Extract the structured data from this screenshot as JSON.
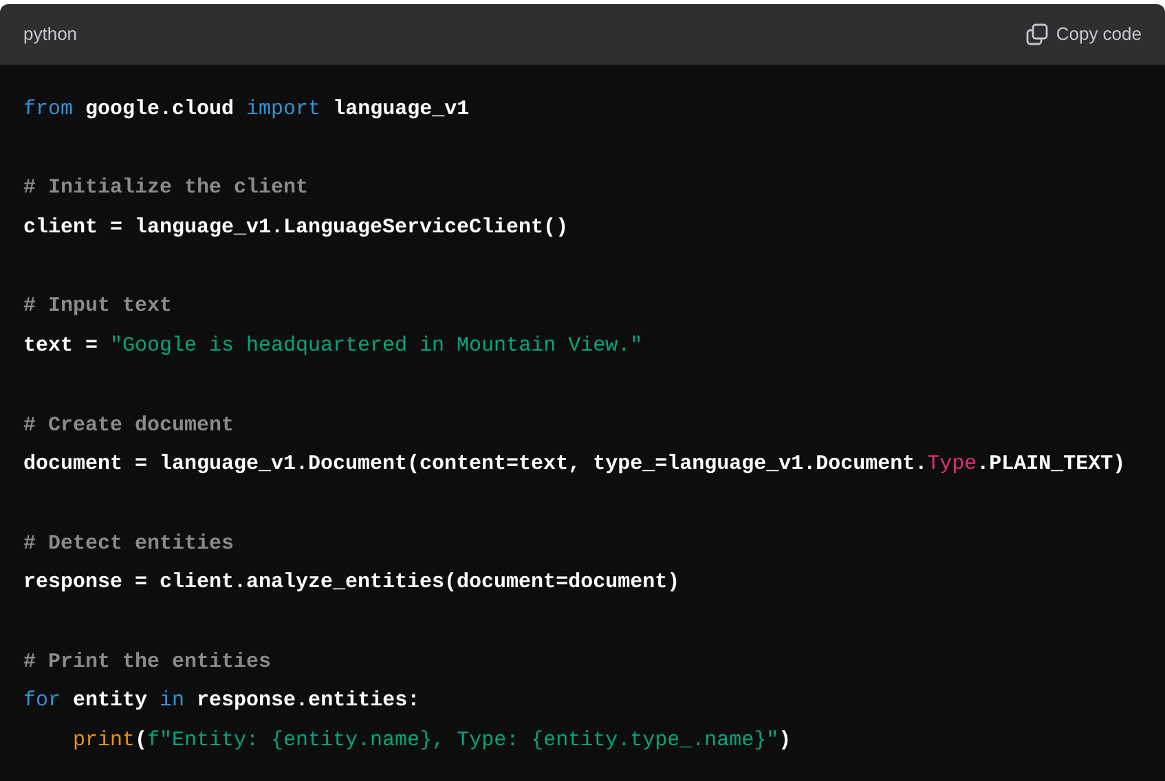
{
  "header": {
    "language": "python",
    "copy_label": "Copy code"
  },
  "lines": [
    {
      "kind": "code",
      "tokens": [
        {
          "kind": "keyword",
          "text": "from"
        },
        {
          "kind": "plain",
          "text": " google.cloud "
        },
        {
          "kind": "keyword",
          "text": "import"
        },
        {
          "kind": "plain",
          "text": " language_v1"
        }
      ]
    },
    {
      "kind": "blank"
    },
    {
      "kind": "code",
      "tokens": [
        {
          "kind": "comment",
          "text": "# Initialize the client"
        }
      ]
    },
    {
      "kind": "code",
      "tokens": [
        {
          "kind": "plain",
          "text": "client = language_v1.LanguageServiceClient()"
        }
      ]
    },
    {
      "kind": "blank"
    },
    {
      "kind": "code",
      "tokens": [
        {
          "kind": "comment",
          "text": "# Input text"
        }
      ]
    },
    {
      "kind": "code",
      "tokens": [
        {
          "kind": "plain",
          "text": "text = "
        },
        {
          "kind": "string",
          "text": "\"Google is headquartered in Mountain View.\""
        }
      ]
    },
    {
      "kind": "blank"
    },
    {
      "kind": "code",
      "tokens": [
        {
          "kind": "comment",
          "text": "# Create document"
        }
      ]
    },
    {
      "kind": "code",
      "tokens": [
        {
          "kind": "plain",
          "text": "document = language_v1.Document(content=text, type_=language_v1.Document."
        },
        {
          "kind": "type",
          "text": "Type"
        },
        {
          "kind": "plain",
          "text": ".PLAIN_TEXT)"
        }
      ]
    },
    {
      "kind": "blank"
    },
    {
      "kind": "code",
      "tokens": [
        {
          "kind": "comment",
          "text": "# Detect entities"
        }
      ]
    },
    {
      "kind": "code",
      "tokens": [
        {
          "kind": "plain",
          "text": "response = client.analyze_entities(document=document)"
        }
      ]
    },
    {
      "kind": "blank"
    },
    {
      "kind": "code",
      "tokens": [
        {
          "kind": "comment",
          "text": "# Print the entities"
        }
      ]
    },
    {
      "kind": "code",
      "tokens": [
        {
          "kind": "keyword",
          "text": "for"
        },
        {
          "kind": "plain",
          "text": " entity "
        },
        {
          "kind": "keyword",
          "text": "in"
        },
        {
          "kind": "plain",
          "text": " response.entities:"
        }
      ]
    },
    {
      "kind": "code",
      "tokens": [
        {
          "kind": "builtin",
          "text": "    print"
        },
        {
          "kind": "plain",
          "text": "("
        },
        {
          "kind": "string",
          "text": "f\"Entity: {entity.name}, Type: {entity.type_.name}\""
        },
        {
          "kind": "plain",
          "text": ")"
        }
      ]
    }
  ]
}
